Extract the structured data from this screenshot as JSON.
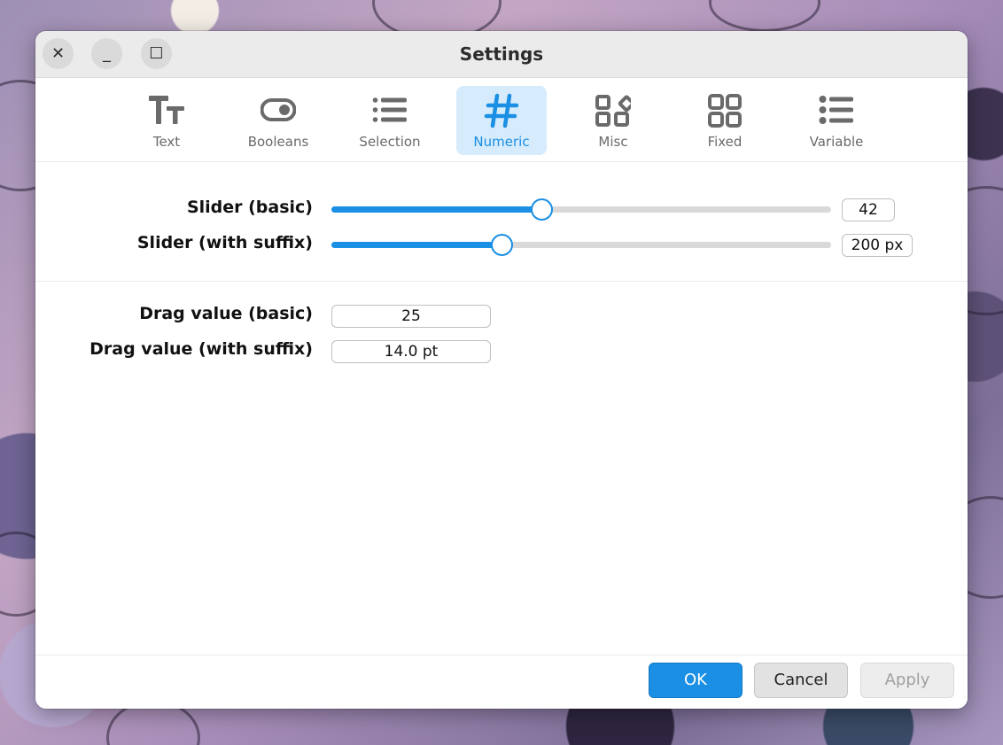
{
  "window": {
    "title": "Settings",
    "controls": {
      "close": "✕",
      "minimize": "_",
      "maximize": "☐"
    }
  },
  "tabs": [
    {
      "label": "Text",
      "icon": "text-icon",
      "active": false
    },
    {
      "label": "Booleans",
      "icon": "toggle-icon",
      "active": false
    },
    {
      "label": "Selection",
      "icon": "list-icon",
      "active": false
    },
    {
      "label": "Numeric",
      "icon": "hash-icon",
      "active": true
    },
    {
      "label": "Misc",
      "icon": "shapes-icon",
      "active": false
    },
    {
      "label": "Fixed",
      "icon": "grid-icon",
      "active": false
    },
    {
      "label": "Variable",
      "icon": "bullet-list-icon",
      "active": false
    }
  ],
  "sliders": {
    "basic": {
      "label": "Slider (basic)",
      "value": "42",
      "fraction": 0.42
    },
    "suffix": {
      "label": "Slider (with suffix)",
      "value": "200 px",
      "fraction": 0.34
    }
  },
  "drags": {
    "basic": {
      "label": "Drag value (basic)",
      "value": "25"
    },
    "suffix": {
      "label": "Drag value (with suffix)",
      "value": "14.0 pt"
    }
  },
  "footer": {
    "ok": "OK",
    "cancel": "Cancel",
    "apply": "Apply"
  },
  "colors": {
    "accent": "#1a8fe3",
    "accent_bg": "#d6ecfc"
  }
}
